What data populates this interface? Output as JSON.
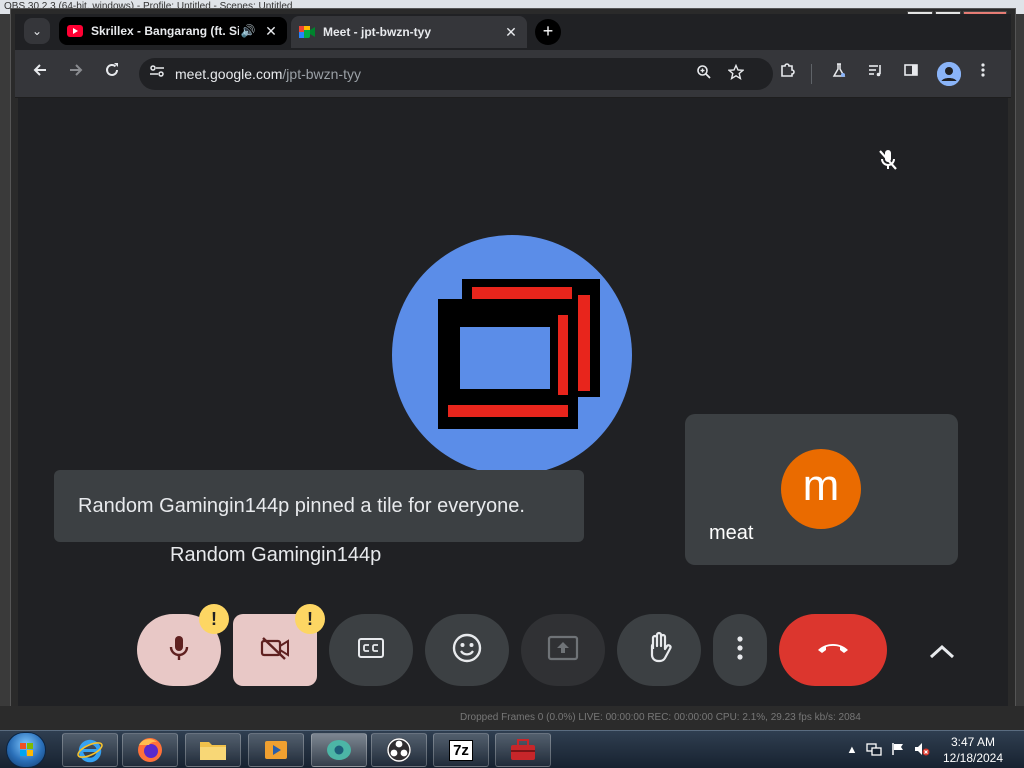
{
  "obs": {
    "title": "OBS 30.2.3 (64-bit, windows) - Profile: Untitled - Scenes: Untitled",
    "status": "Dropped Frames 0 (0.0%)    LIVE: 00:00:00    REC: 00:00:00    CPU: 2.1%, 29.23 fps    kb/s: 2084"
  },
  "window": {
    "minimize": "▁",
    "maximize": "▢",
    "close": "✕"
  },
  "tabs": [
    {
      "title": "Skrillex - Bangarang (ft. Sirah)",
      "audio": "🔊",
      "close": "✕"
    },
    {
      "title": "Meet - jpt-bwzn-tyy",
      "close": "✕"
    }
  ],
  "new_tab": "+",
  "tab_list": "⌄",
  "address": {
    "domain": "meet.google.com",
    "path": "/jpt-bwzn-tyy"
  },
  "meet": {
    "toast": "Random Gamingin144p pinned a tile for everyone.",
    "participant_name": "Random Gamingin144p",
    "self_name": "meat",
    "self_initial": "m",
    "warning": "!"
  },
  "taskbar": {
    "time": "3:47 AM",
    "date": "12/18/2024",
    "sevenzip": "7z",
    "tray_arrow": "▲"
  },
  "colors": {
    "meet_bg": "#202124",
    "end_call": "#dc362e",
    "warning": "#fdd663",
    "self_avatar": "#ea6b00",
    "participant_avatar": "#5b8de8"
  }
}
